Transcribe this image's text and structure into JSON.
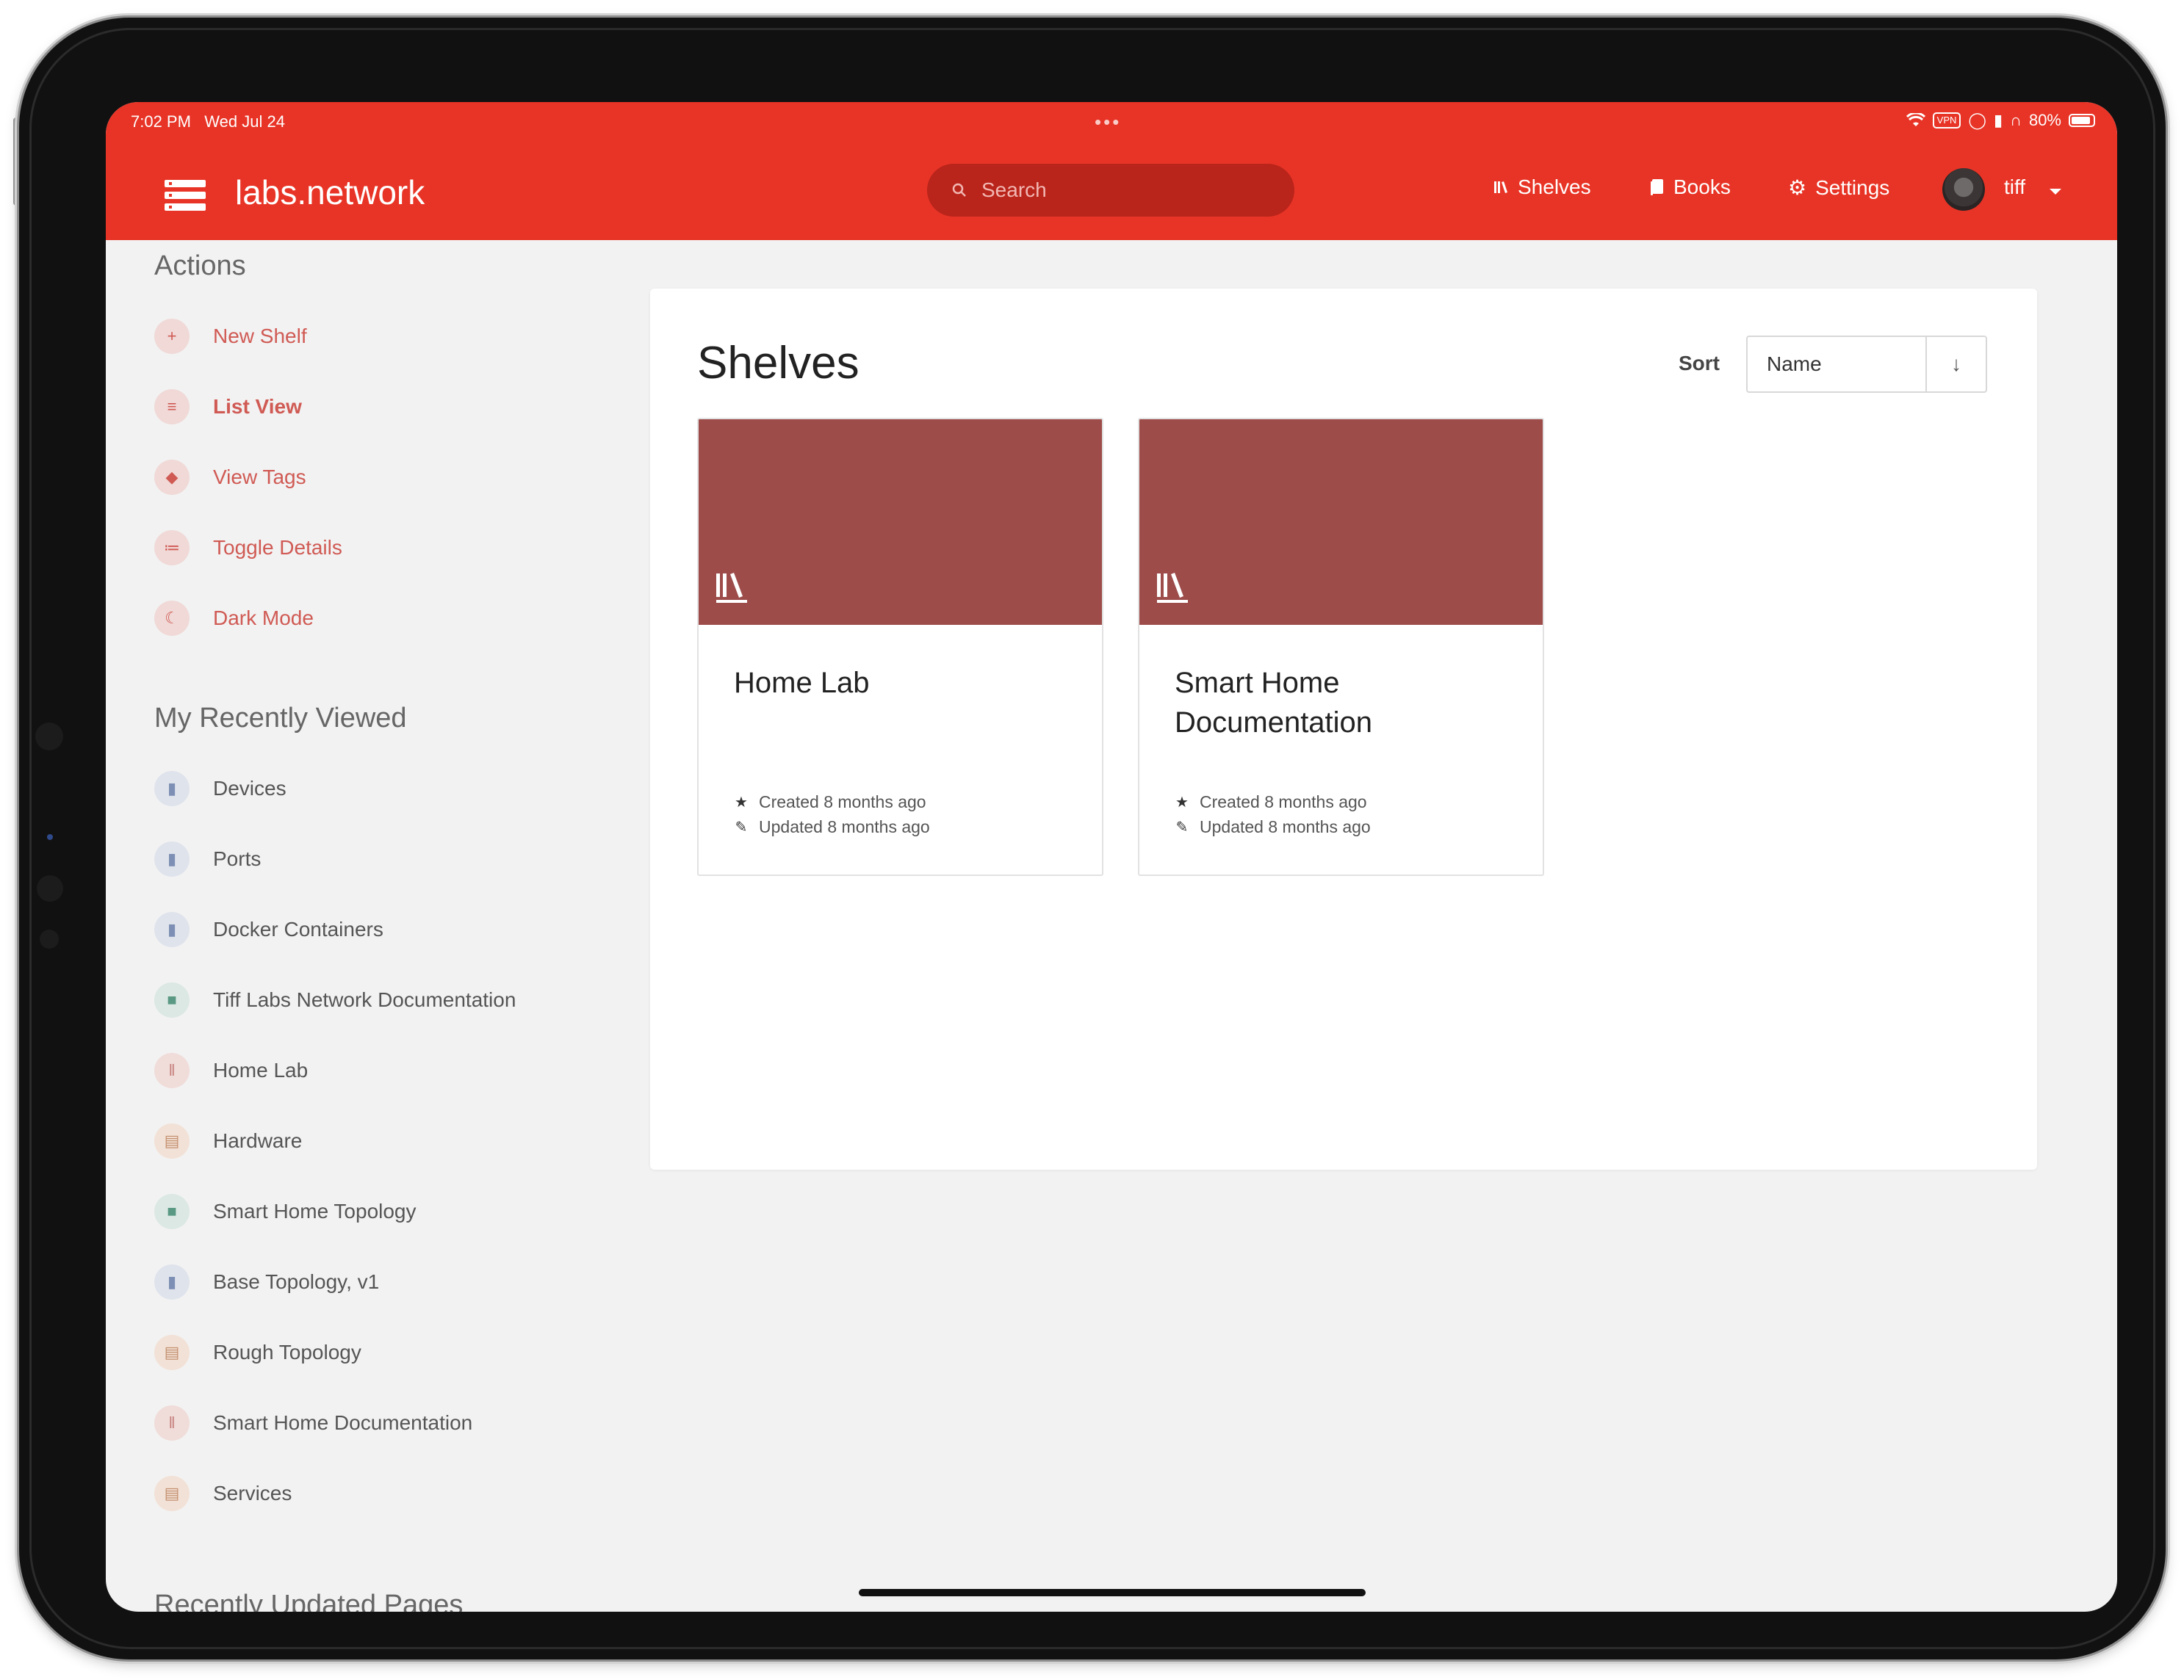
{
  "status_bar": {
    "time_date": "7:02 PM   Wed Jul 24",
    "multitask": "•••",
    "vpn": "VPN",
    "battery": "80%"
  },
  "header": {
    "brand": "labs.network",
    "search_placeholder": "Search",
    "nav": {
      "shelves": "Shelves",
      "books": "Books",
      "settings": "Settings"
    },
    "user": "tiff",
    "accent_color": "#e83426"
  },
  "sidebar": {
    "actions_title": "Actions",
    "actions": [
      {
        "label": "New Shelf",
        "icon": "plus-icon"
      },
      {
        "label": "List View",
        "icon": "list-icon"
      },
      {
        "label": "View Tags",
        "icon": "tag-icon"
      },
      {
        "label": "Toggle Details",
        "icon": "details-icon"
      },
      {
        "label": "Dark Mode",
        "icon": "moon-icon"
      }
    ],
    "recent_title": "My Recently Viewed",
    "recent": [
      {
        "label": "Devices",
        "icon": "page-icon"
      },
      {
        "label": "Ports",
        "icon": "page-icon"
      },
      {
        "label": "Docker Containers",
        "icon": "page-icon"
      },
      {
        "label": "Tiff Labs Network Documentation",
        "icon": "book-icon"
      },
      {
        "label": "Home Lab",
        "icon": "shelf-icon"
      },
      {
        "label": "Hardware",
        "icon": "chapter-icon"
      },
      {
        "label": "Smart Home Topology",
        "icon": "book-icon"
      },
      {
        "label": "Base Topology, v1",
        "icon": "page-icon"
      },
      {
        "label": "Rough Topology",
        "icon": "chapter-icon"
      },
      {
        "label": "Smart Home Documentation",
        "icon": "shelf-icon"
      },
      {
        "label": "Services",
        "icon": "chapter-icon"
      }
    ],
    "updated_title": "Recently Updated Pages"
  },
  "main": {
    "title": "Shelves",
    "sort_label": "Sort",
    "sort_value": "Name",
    "sort_direction": "↓",
    "cards": [
      {
        "title": "Home Lab",
        "created": "Created 8 months ago",
        "updated": "Updated 8 months ago",
        "cover_color": "#9d4c4a"
      },
      {
        "title": "Smart Home Documentation",
        "created": "Created 8 months ago",
        "updated": "Updated 8 months ago",
        "cover_color": "#9d4c4a"
      }
    ]
  }
}
